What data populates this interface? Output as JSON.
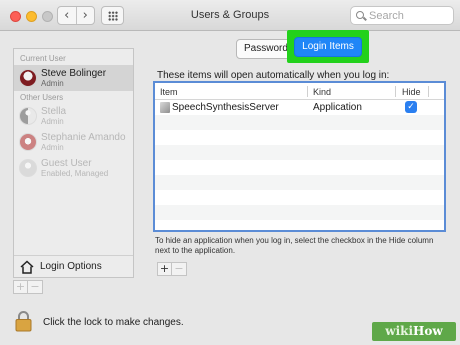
{
  "window": {
    "title": "Users & Groups",
    "nav_back": "‹",
    "nav_forward": "›"
  },
  "search": {
    "placeholder": "Search"
  },
  "sidebar": {
    "current_user_label": "Current User",
    "current_user": {
      "name": "Steve Bolinger",
      "role": "Admin",
      "avatar": "wine-glass-avatar"
    },
    "other_users_label": "Other Users",
    "other_users": [
      {
        "name": "Stella",
        "role": "Admin",
        "avatar": "yin-yang-avatar"
      },
      {
        "name": "Stephanie Amando",
        "role": "Admin",
        "avatar": "red-avatar"
      },
      {
        "name": "Guest User",
        "role": "Enabled, Managed",
        "avatar": "guest-avatar"
      }
    ],
    "login_options": "Login Options",
    "add_button": "+",
    "remove_button": "−"
  },
  "tabs": [
    {
      "label": "Password",
      "active": false
    },
    {
      "label": "Login Items",
      "active": true
    }
  ],
  "highlight_color": "#23d11c",
  "accent_color": "#1f86f7",
  "main": {
    "info_text": "These items will open automatically when you log in:",
    "columns": [
      "Item",
      "Kind",
      "Hide"
    ],
    "rows": [
      {
        "item": "SpeechSynthesisServer",
        "kind": "Application",
        "hide": true
      }
    ],
    "hint": "To hide an application when you log in, select the checkbox in the Hide column next to the application.",
    "add_button": "+",
    "remove_button": "−"
  },
  "footer": {
    "lock_text": "Click the lock to make changes."
  },
  "watermark": {
    "part1": "wiki",
    "part2": "How"
  }
}
